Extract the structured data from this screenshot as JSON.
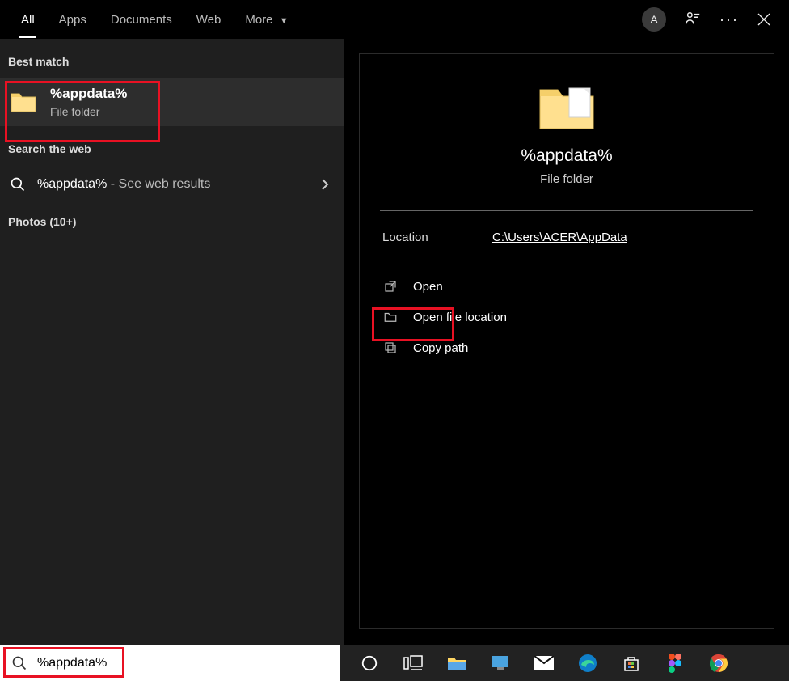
{
  "tabs": {
    "all": "All",
    "apps": "Apps",
    "documents": "Documents",
    "web": "Web",
    "more": "More"
  },
  "avatar": "A",
  "left": {
    "best_match": "Best match",
    "result_title": "%appdata%",
    "result_sub": "File folder",
    "search_web": "Search the web",
    "web_query": "%appdata%",
    "web_suffix": " - See web results",
    "photos": "Photos (10+)"
  },
  "preview": {
    "title": "%appdata%",
    "sub": "File folder",
    "location_label": "Location",
    "location_path": "C:\\Users\\ACER\\AppData",
    "action_open": "Open",
    "action_open_loc": "Open file location",
    "action_copy": "Copy path"
  },
  "search_value": "%appdata%"
}
